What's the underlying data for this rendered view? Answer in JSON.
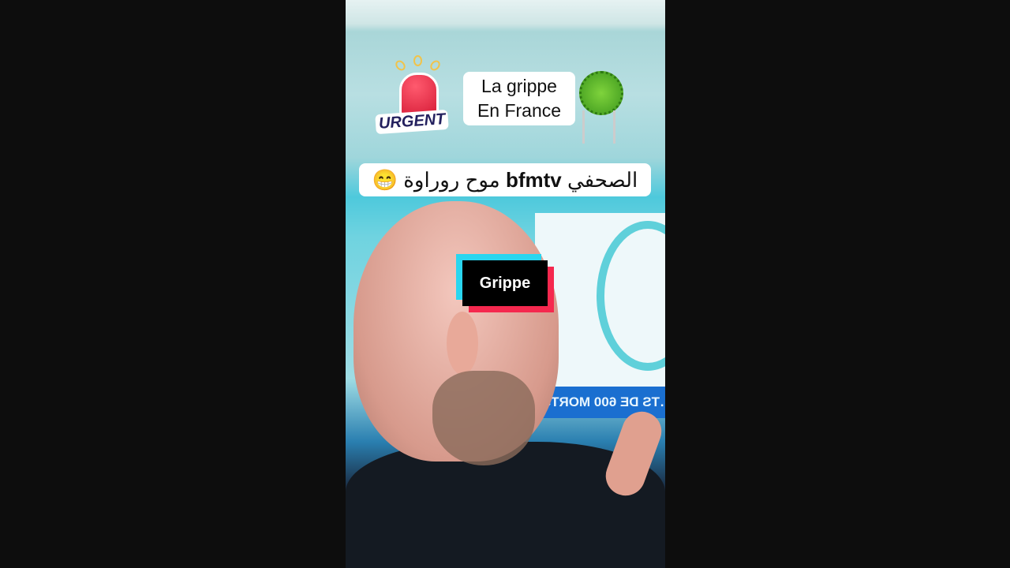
{
  "overlay": {
    "urgent_sticker": "URGENT",
    "title_line1": "La grippe",
    "title_line2": "En France",
    "caption_arabic_1": "الصحفي",
    "caption_brand": "bfmtv",
    "caption_arabic_2": "موح روراوة",
    "caption_emoji": "😁",
    "tag_label": "Grippe"
  },
  "background": {
    "tv_banner_mirrored": "…TS DE 600 MORTS EN …"
  },
  "colors": {
    "tag_cyan": "#2ad6ef",
    "tag_red": "#f5284e",
    "urgent_text": "#23205e",
    "siren": "#d81f3a",
    "virus": "#5cb82c"
  }
}
